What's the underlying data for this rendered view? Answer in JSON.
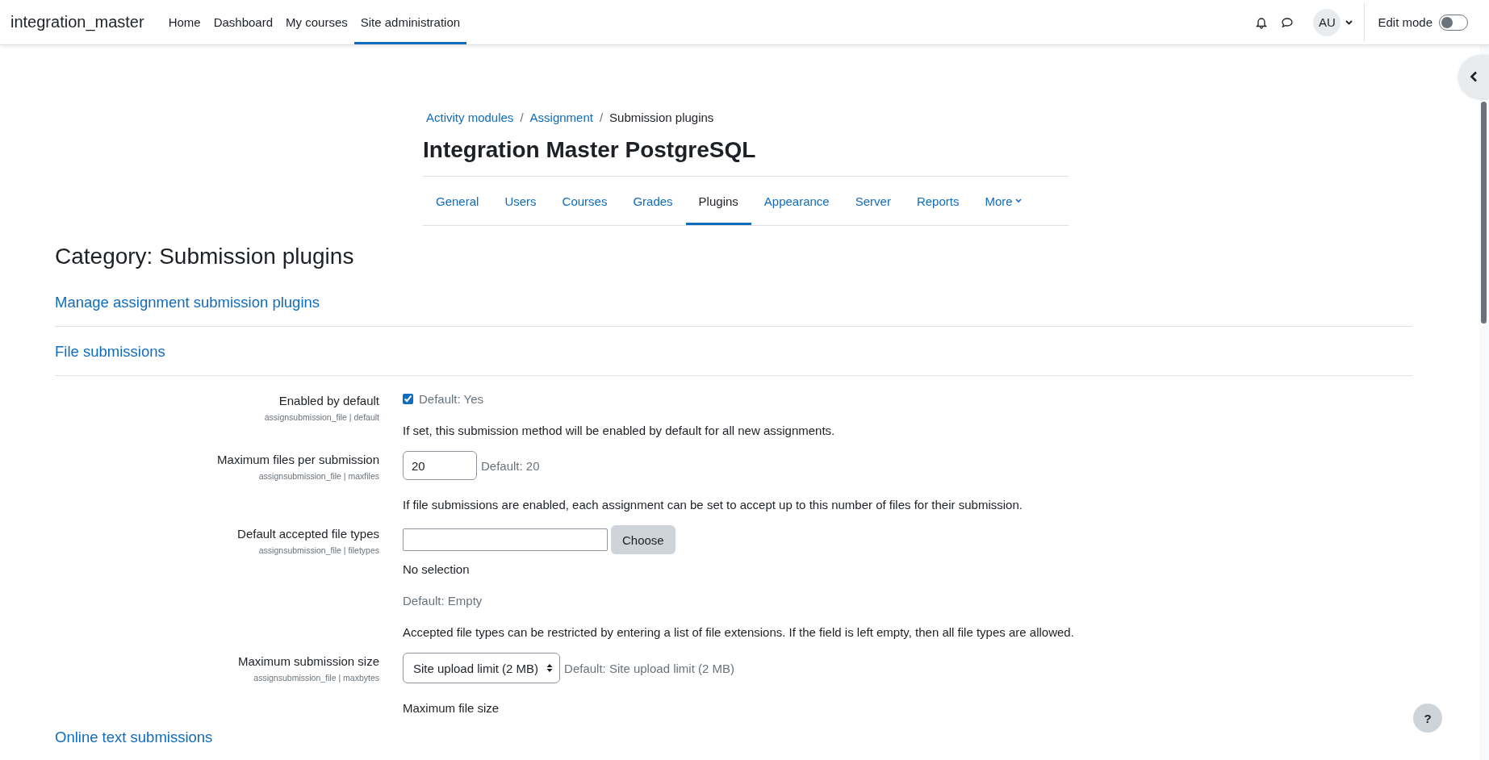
{
  "navbar": {
    "brand": "integration_master",
    "links": [
      {
        "label": "Home",
        "selected": false
      },
      {
        "label": "Dashboard",
        "selected": false
      },
      {
        "label": "My courses",
        "selected": false
      },
      {
        "label": "Site administration",
        "selected": true
      }
    ],
    "avatar": "AU",
    "edit_mode": {
      "label": "Edit mode",
      "on": false
    }
  },
  "breadcrumb_separator": "/",
  "breadcrumb": [
    {
      "label": "Activity modules",
      "link": true
    },
    {
      "label": "Assignment",
      "link": true
    },
    {
      "label": "Submission plugins",
      "link": false
    }
  ],
  "page_title": "Integration Master PostgreSQL",
  "tabs": [
    {
      "label": "General",
      "selected": false
    },
    {
      "label": "Users",
      "selected": false
    },
    {
      "label": "Courses",
      "selected": false
    },
    {
      "label": "Grades",
      "selected": false
    },
    {
      "label": "Plugins",
      "selected": true
    },
    {
      "label": "Appearance",
      "selected": false
    },
    {
      "label": "Server",
      "selected": false
    },
    {
      "label": "Reports",
      "selected": false
    },
    {
      "label": "More",
      "selected": false,
      "dropdown": true
    }
  ],
  "category_heading": "Category: Submission plugins",
  "manage_link": "Manage assignment submission plugins",
  "section_title": "File submissions",
  "settings": [
    {
      "kind": "checkbox",
      "label": "Enabled by default",
      "key": "assignsubmission_file | default",
      "checked": true,
      "default": "Default: Yes",
      "help": "If set, this submission method will be enabled by default for all new assignments."
    },
    {
      "kind": "text",
      "label": "Maximum files per submission",
      "key": "assignsubmission_file | maxfiles",
      "value": "20",
      "default": "Default: 20",
      "help": "If file submissions are enabled, each assignment can be set to accept up to this number of files for their submission."
    },
    {
      "kind": "filetypes",
      "label": "Default accepted file types",
      "key": "assignsubmission_file | filetypes",
      "button": "Choose",
      "selection": "No selection",
      "default": "Default: Empty",
      "help": "Accepted file types can be restricted by entering a list of file extensions. If the field is left empty, then all file types are allowed."
    },
    {
      "kind": "select",
      "label": "Maximum submission size",
      "key": "assignsubmission_file | maxbytes",
      "value": "Site upload limit (2 MB)",
      "default": "Default: Site upload limit (2 MB)",
      "help": "Maximum file size"
    }
  ],
  "next_section_title": "Online text submissions",
  "help_button": "?"
}
